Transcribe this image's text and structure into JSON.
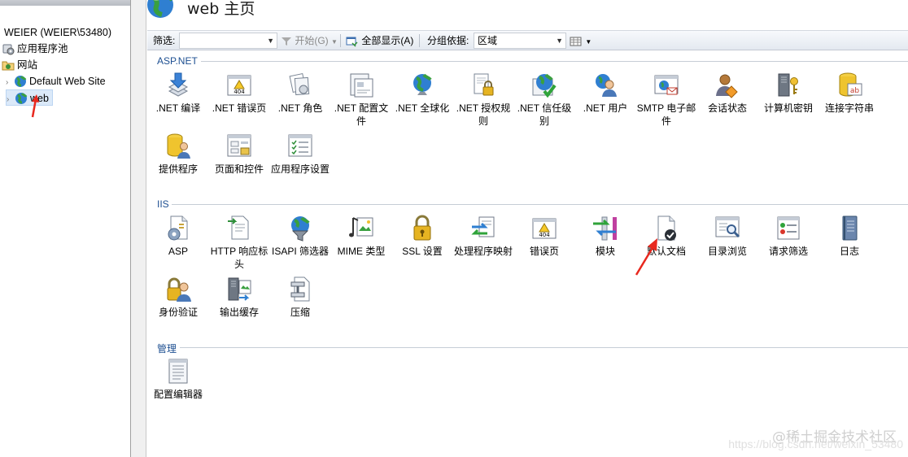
{
  "tree": {
    "server": "WEIER (WEIER\\53480)",
    "app_pools": "应用程序池",
    "sites": "网站",
    "default_site": "Default Web Site",
    "web": "web"
  },
  "header": {
    "title": "web 主页"
  },
  "toolbar": {
    "filter_label": "筛选:",
    "filter_value": "",
    "start_label": "开始(G)",
    "show_all_label": "全部显示(A)",
    "group_label": "分组依据:",
    "group_value": "区域"
  },
  "sections": [
    {
      "title": "ASP.NET",
      "items": [
        {
          "label": ".NET 编译",
          "icon": "download-stack-icon"
        },
        {
          "label": ".NET 错误页",
          "icon": "error-404-icon"
        },
        {
          "label": ".NET 角色",
          "icon": "roles-documents-icon"
        },
        {
          "label": ".NET 配置文件",
          "icon": "profile-window-icon"
        },
        {
          "label": ".NET 全球化",
          "icon": "globe-icon"
        },
        {
          "label": ".NET 授权规则",
          "icon": "lock-document-icon"
        },
        {
          "label": ".NET 信任级别",
          "icon": "trust-globe-icon"
        },
        {
          "label": ".NET 用户",
          "icon": "users-icon"
        },
        {
          "label": "SMTP 电子邮件",
          "icon": "email-globe-icon"
        },
        {
          "label": "会话状态",
          "icon": "session-user-icon"
        },
        {
          "label": "计算机密钥",
          "icon": "machine-key-icon"
        },
        {
          "label": "连接字符串",
          "icon": "connection-db-icon"
        },
        {
          "label": "提供程序",
          "icon": "providers-db-icon"
        },
        {
          "label": "页面和控件",
          "icon": "pages-controls-icon"
        },
        {
          "label": "应用程序设置",
          "icon": "app-settings-icon"
        }
      ]
    },
    {
      "title": "IIS",
      "items": [
        {
          "label": "ASP",
          "icon": "asp-gear-icon"
        },
        {
          "label": "HTTP 响应标头",
          "icon": "http-headers-icon"
        },
        {
          "label": "ISAPI 筛选器",
          "icon": "isapi-filter-icon"
        },
        {
          "label": "MIME 类型",
          "icon": "mime-media-icon"
        },
        {
          "label": "SSL 设置",
          "icon": "padlock-icon"
        },
        {
          "label": "处理程序映射",
          "icon": "handler-arrows-icon"
        },
        {
          "label": "错误页",
          "icon": "error-404-icon"
        },
        {
          "label": "模块",
          "icon": "modules-icon"
        },
        {
          "label": "默认文档",
          "icon": "default-document-icon"
        },
        {
          "label": "目录浏览",
          "icon": "directory-browse-icon"
        },
        {
          "label": "请求筛选",
          "icon": "request-filter-icon"
        },
        {
          "label": "日志",
          "icon": "log-book-icon"
        },
        {
          "label": "身份验证",
          "icon": "authentication-icon"
        },
        {
          "label": "输出缓存",
          "icon": "output-cache-icon"
        },
        {
          "label": "压缩",
          "icon": "compression-icon"
        }
      ]
    },
    {
      "title": "管理",
      "items": [
        {
          "label": "配置编辑器",
          "icon": "config-editor-icon"
        }
      ]
    }
  ],
  "watermark": {
    "text": "@稀土掘金技术社区",
    "url": "https://blog.csdn.net/weixin_53480"
  }
}
